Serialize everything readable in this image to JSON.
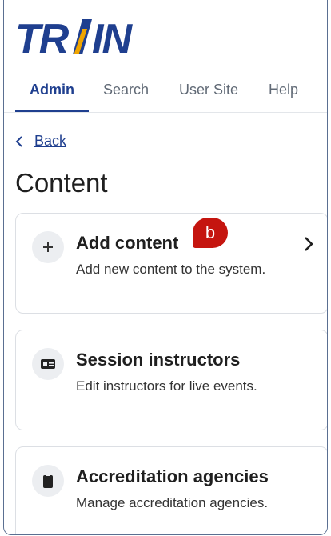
{
  "brand": {
    "logo_text": "TRAIN",
    "accent": "#f0a500",
    "primary": "#1f3f8f"
  },
  "nav": {
    "tabs": [
      {
        "label": "Admin",
        "active": true
      },
      {
        "label": "Search",
        "active": false
      },
      {
        "label": "User Site",
        "active": false
      },
      {
        "label": "Help",
        "active": false
      }
    ]
  },
  "back": {
    "label": "Back",
    "icon": "chevron-left-icon"
  },
  "page": {
    "title": "Content"
  },
  "cards": [
    {
      "title": "Add content",
      "description": "Add new content to the system.",
      "icon": "plus-icon",
      "has_chevron": true
    },
    {
      "title": "Session instructors",
      "description": "Edit instructors for live events.",
      "icon": "id-card-icon"
    },
    {
      "title": "Accreditation agencies",
      "description": "Manage accreditation agencies.",
      "icon": "clipboard-icon"
    }
  ],
  "badge": {
    "label": "b",
    "color": "#c5150f"
  }
}
